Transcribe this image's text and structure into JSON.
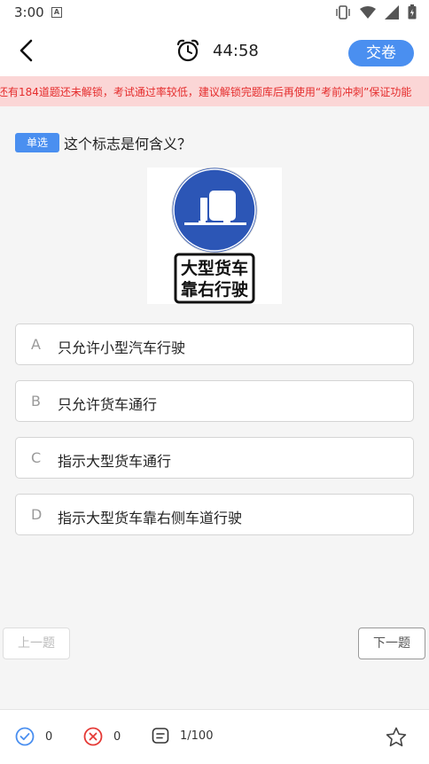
{
  "status_bar": {
    "time": "3:00",
    "notif_icon_letter": "A"
  },
  "header": {
    "timer": "44:58",
    "submit_label": "交卷"
  },
  "notice": {
    "text": "还有184道题还未解锁，考试通过率较低，建议解锁完题库后再使用“考前冲刺”保证功能"
  },
  "question": {
    "type_label": "单选",
    "text": "这个标志是何含义？",
    "sign_line1": "大型货车",
    "sign_line2": "靠右行驶"
  },
  "options": [
    {
      "letter": "A",
      "text": "只允许小型汽车行驶"
    },
    {
      "letter": "B",
      "text": "只允许货车通行"
    },
    {
      "letter": "C",
      "text": "指示大型货车通行"
    },
    {
      "letter": "D",
      "text": "指示大型货车靠右侧车道行驶"
    }
  ],
  "nav": {
    "prev_label": "上一题",
    "next_label": "下一题"
  },
  "bottom": {
    "correct_count": "0",
    "wrong_count": "0",
    "progress": "1/100"
  },
  "colors": {
    "accent": "#4a8ff0",
    "wrong": "#e53935",
    "notice_bg": "#fbd6d6",
    "notice_text": "#e52d2d",
    "sign_blue": "#2c56b6"
  }
}
